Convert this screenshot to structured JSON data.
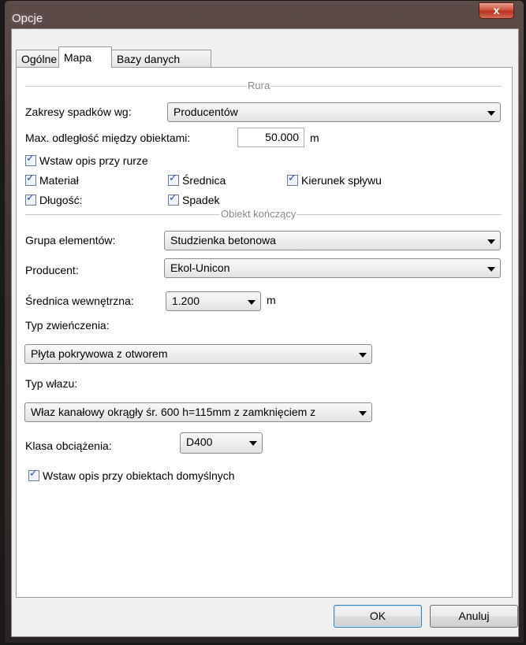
{
  "window": {
    "title": "Opcje",
    "close_label": "x"
  },
  "tabs": [
    {
      "label": "Ogólne",
      "active": false
    },
    {
      "label": "Mapa",
      "active": true
    },
    {
      "label": "Bazy danych",
      "active": false
    }
  ],
  "rura": {
    "section_title": "Rura",
    "zakresy_label": "Zakresy spadków wg:",
    "zakresy_value": "Producentów",
    "max_odl_label": "Max. odległość między obiektami:",
    "max_odl_value": "50.000",
    "max_odl_unit": "m",
    "checks": {
      "wstaw_opis": "Wstaw opis przy rurze",
      "material": "Materiał",
      "srednica": "Średnica",
      "kierunek": "Kierunek spływu",
      "dlugosc": "Długość:",
      "spadek": "Spadek"
    }
  },
  "obiekt": {
    "section_title": "Obiekt kończący",
    "grupa_label": "Grupa elementów:",
    "grupa_value": "Studzienka betonowa",
    "producent_label": "Producent:",
    "producent_value": "Ekol-Unicon",
    "srednica_label": "Średnica wewnętrzna:",
    "srednica_value": "1.200",
    "srednica_unit": "m",
    "typ_zwienczenia_label": "Typ zwieńczenia:",
    "typ_zwienczenia_value": "Płyta pokrywowa z otworem",
    "typ_wlazu_label": "Typ włazu:",
    "typ_wlazu_value": "Właz kanałowy okrągły śr. 600 h=115mm z zamknięciem z",
    "klasa_label": "Klasa obciążenia:",
    "klasa_value": "D400",
    "wstaw_opis_domyslne": "Wstaw opis przy obiektach domyślnych"
  },
  "buttons": {
    "ok": "OK",
    "cancel": "Anuluj"
  }
}
